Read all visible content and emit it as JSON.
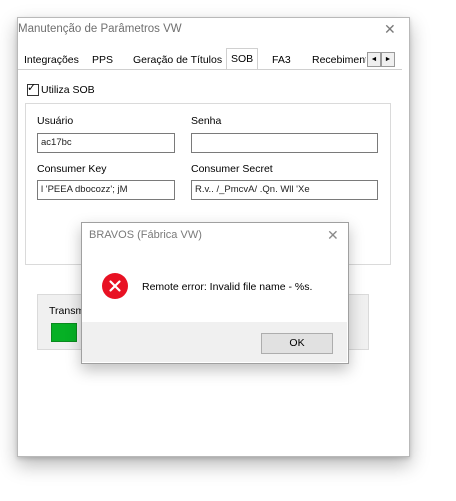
{
  "window": {
    "title": "Manutenção de Parâmetros VW",
    "close_glyph": "✕"
  },
  "tabs": [
    {
      "label": "Integrações"
    },
    {
      "label": "PPS"
    },
    {
      "label": "Geração de Títulos"
    },
    {
      "label": "SOB",
      "active": true
    },
    {
      "label": "FA3"
    },
    {
      "label": "Recebiment"
    }
  ],
  "tab_scroll": {
    "left_glyph": "◄",
    "right_glyph": "►"
  },
  "sob": {
    "utiliza_checked": true,
    "utiliza_label": "Utiliza SOB",
    "usuario_label": "Usuário",
    "usuario_value": "ac17bc",
    "senha_label": "Senha",
    "senha_value": "",
    "consumer_key_label": "Consumer Key",
    "consumer_key_value": "l          'PEEA dbocozz'; jM",
    "consumer_secret_label": "Consumer Secret",
    "consumer_secret_value": "R.v.. /_PmcvA/ .Qn. Wll 'Xe"
  },
  "transmission": {
    "label": "Transm",
    "progress_fraction": 0.07
  },
  "dialog": {
    "title": "BRAVOS (Fábrica VW)",
    "close_glyph": "✕",
    "icon": "error-icon",
    "message": "Remote error: Invalid file name - %s.",
    "ok_label": "OK"
  },
  "colors": {
    "error_red": "#e81123",
    "progress_green": "#06b025"
  }
}
